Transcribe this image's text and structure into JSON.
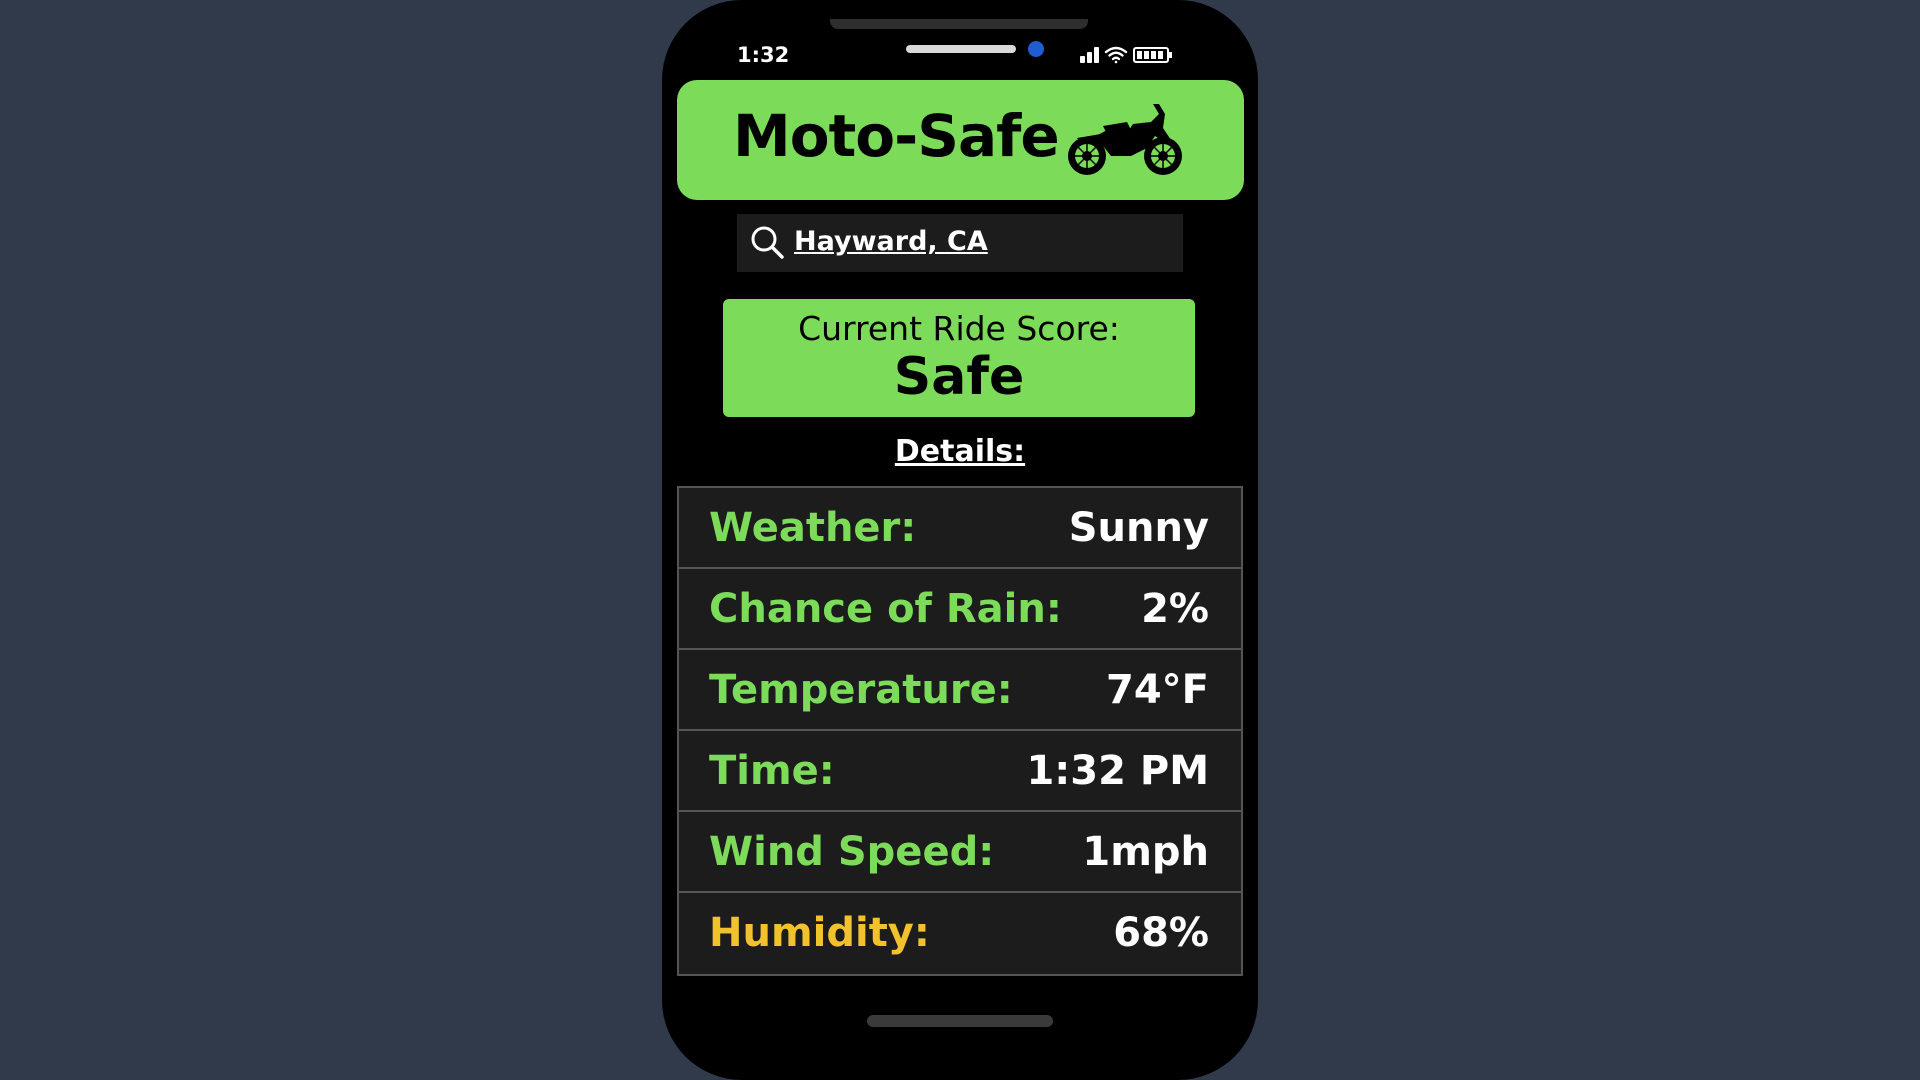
{
  "status_bar": {
    "time": "1:32"
  },
  "header": {
    "title": "Moto-Safe",
    "icon": "motorcycle-icon"
  },
  "search": {
    "value": "Hayward, CA",
    "icon": "search-icon"
  },
  "ride_score": {
    "label": "Current Ride Score:",
    "value": "Safe"
  },
  "details": {
    "heading": "Details:",
    "rows": [
      {
        "label": "Weather:",
        "value": "Sunny",
        "status": "good"
      },
      {
        "label": "Chance of Rain:",
        "value": "2%",
        "status": "good"
      },
      {
        "label": "Temperature:",
        "value": "74°F",
        "status": "good"
      },
      {
        "label": "Time:",
        "value": "1:32 PM",
        "status": "good"
      },
      {
        "label": "Wind Speed:",
        "value": "1mph",
        "status": "good"
      },
      {
        "label": "Humidity:",
        "value": "68%",
        "status": "warning"
      }
    ]
  },
  "colors": {
    "accent_green": "#7ddb5a",
    "warning_yellow": "#f2c12e",
    "background": "#303a4a",
    "phone_body": "#000000"
  }
}
